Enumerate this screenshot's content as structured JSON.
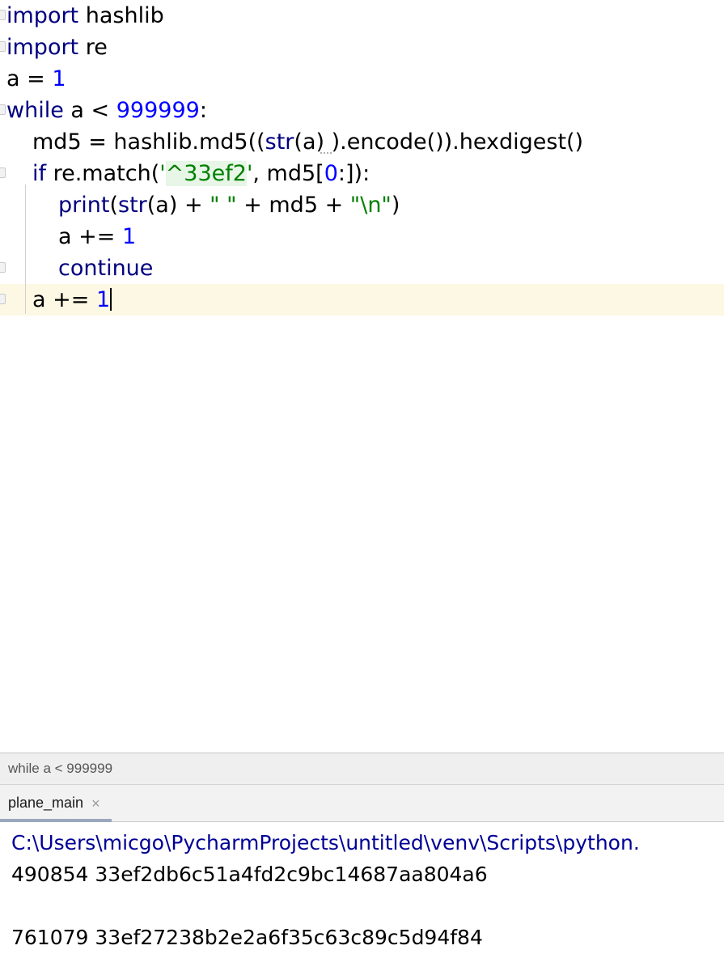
{
  "editor": {
    "lines": [
      {
        "id": "line-1",
        "indent": 0,
        "gutter": true,
        "tokens": [
          {
            "t": "import",
            "c": "kw"
          },
          {
            "t": " hashlib",
            "c": "plain"
          }
        ]
      },
      {
        "id": "line-2",
        "indent": 0,
        "gutter": true,
        "tokens": [
          {
            "t": "import",
            "c": "kw"
          },
          {
            "t": " re",
            "c": "plain"
          }
        ]
      },
      {
        "id": "line-3",
        "indent": 0,
        "gutter": false,
        "tokens": [
          {
            "t": "a = ",
            "c": "plain"
          },
          {
            "t": "1",
            "c": "num"
          }
        ]
      },
      {
        "id": "line-4",
        "indent": 0,
        "gutter": true,
        "tokens": [
          {
            "t": "while",
            "c": "kw"
          },
          {
            "t": " a < ",
            "c": "plain"
          },
          {
            "t": "999999",
            "c": "num"
          },
          {
            "t": ":",
            "c": "plain"
          }
        ]
      },
      {
        "id": "line-5",
        "indent": 1,
        "gutter": false,
        "tokens": [
          {
            "t": "md5 = hashlib.md5((",
            "c": "plain"
          },
          {
            "t": "str",
            "c": "fn"
          },
          {
            "t": "(a) ).encode()).hexdigest()",
            "c": "plain"
          }
        ]
      },
      {
        "id": "line-6",
        "indent": 1,
        "gutter": true,
        "tokens": [
          {
            "t": "if",
            "c": "kw"
          },
          {
            "t": " re.match(",
            "c": "plain"
          },
          {
            "t": "'",
            "c": "str"
          },
          {
            "t": "^33ef2",
            "c": "str-hl"
          },
          {
            "t": "'",
            "c": "str"
          },
          {
            "t": ", md5[",
            "c": "plain"
          },
          {
            "t": "0",
            "c": "num"
          },
          {
            "t": ":]):",
            "c": "plain"
          }
        ]
      },
      {
        "id": "line-7",
        "indent": 2,
        "gutter": false,
        "tokens": [
          {
            "t": "print",
            "c": "fn"
          },
          {
            "t": "(",
            "c": "plain"
          },
          {
            "t": "str",
            "c": "fn"
          },
          {
            "t": "(a) + ",
            "c": "plain"
          },
          {
            "t": "\" \"",
            "c": "str"
          },
          {
            "t": " + md5 + ",
            "c": "plain"
          },
          {
            "t": "\"\\n\"",
            "c": "str"
          },
          {
            "t": ")",
            "c": "plain"
          }
        ]
      },
      {
        "id": "line-8",
        "indent": 2,
        "gutter": false,
        "tokens": [
          {
            "t": "a += ",
            "c": "plain"
          },
          {
            "t": "1",
            "c": "num"
          }
        ]
      },
      {
        "id": "line-9",
        "indent": 2,
        "gutter": true,
        "tokens": [
          {
            "t": "continue",
            "c": "kw"
          }
        ]
      },
      {
        "id": "line-10",
        "indent": 1,
        "gutter": true,
        "current": true,
        "caret": true,
        "tokens": [
          {
            "t": "a += ",
            "c": "plain"
          },
          {
            "t": "1",
            "c": "num"
          }
        ]
      }
    ]
  },
  "breadcrumb": {
    "text": "while a < 999999"
  },
  "run_window": {
    "tabs": [
      {
        "label": "plane_main",
        "close_icon": "×",
        "active": true
      }
    ],
    "console": [
      {
        "text": "C:\\Users\\micgo\\PycharmProjects\\untitled\\venv\\Scripts\\python.",
        "kind": "path"
      },
      {
        "text": "490854 33ef2db6c51a4fd2c9bc14687aa804a6",
        "kind": "out"
      },
      {
        "text": " ",
        "kind": "blank"
      },
      {
        "text": "761079 33ef27238b2e2a6f35c63c89c5d94f84",
        "kind": "out"
      }
    ]
  },
  "colors": {
    "keyword": "#000080",
    "number": "#0000ff",
    "string": "#008000",
    "string_highlight_bg": "#e7f6e7",
    "current_line_bg": "#fdf8e3",
    "breadcrumb_bg": "#efefef",
    "tab_indicator": "#9aa7bd",
    "console_path": "#000096"
  }
}
